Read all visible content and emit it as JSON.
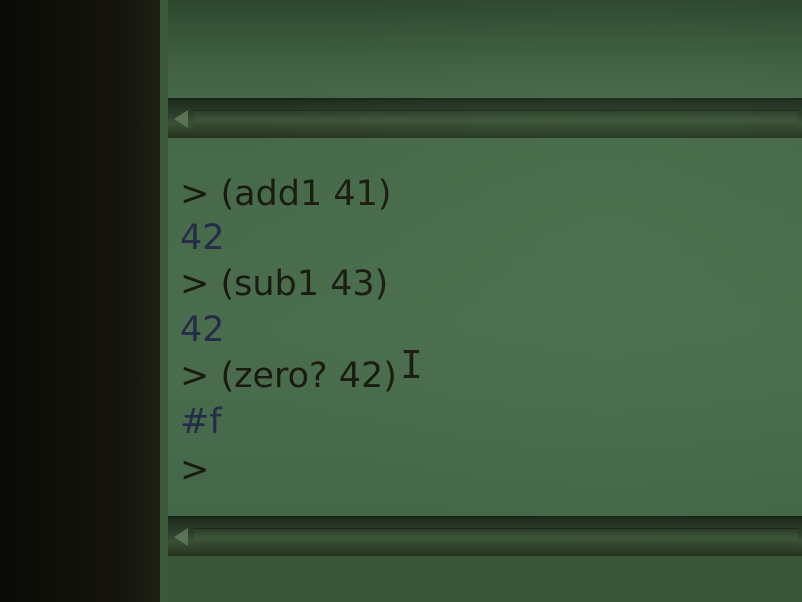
{
  "window": {
    "background_color": "#466a49"
  },
  "interactions": {
    "lines": [
      {
        "kind": "input",
        "text": "> (add1 41)"
      },
      {
        "kind": "output",
        "text": "42"
      },
      {
        "kind": "input",
        "text": "> (sub1 43)"
      },
      {
        "kind": "output",
        "text": "42"
      },
      {
        "kind": "input",
        "text": "> (zero? 42)"
      },
      {
        "kind": "output",
        "text": "#f"
      },
      {
        "kind": "input",
        "text": ">"
      }
    ]
  },
  "icons": {
    "scroll_left": "left-triangle-arrow-icon",
    "text_cursor": "i-beam-cursor-icon"
  },
  "colors": {
    "input_text": "#1a1a10",
    "output_text": "#252c4a"
  }
}
